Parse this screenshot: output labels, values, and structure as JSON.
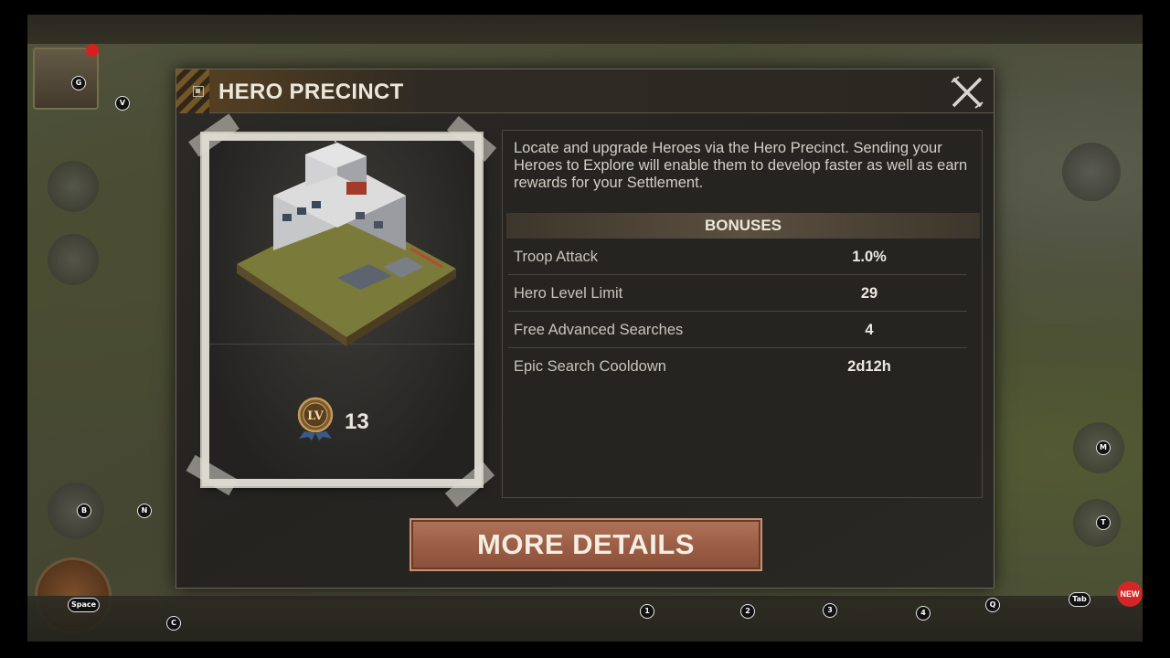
{
  "modal": {
    "title": "HERO PRECINCT",
    "description": "Locate and upgrade Heroes via the Hero Precinct. Sending your Heroes to Explore will enable them to develop faster as well as earn rewards for your Settlement.",
    "bonuses_title": "BONUSES",
    "bonuses": [
      {
        "label": "Troop Attack",
        "value": "1.0%"
      },
      {
        "label": "Hero Level Limit",
        "value": "29"
      },
      {
        "label": "Free Advanced Searches",
        "value": "4"
      },
      {
        "label": "Epic Search Cooldown",
        "value": "2d12h"
      }
    ],
    "level": "13",
    "more_details_label": "MORE DETAILS",
    "close_icon": "close-icon"
  },
  "key_hints": {
    "avatar": "G",
    "vip": "V",
    "b": "B",
    "n": "N",
    "space": "Space",
    "chat": "C",
    "slot1": "1",
    "slot2": "2",
    "slot3": "3",
    "slot4": "4",
    "backpack": "Q",
    "more": "Tab",
    "map": "M",
    "t": "T"
  },
  "colors": {
    "accent_button": "#9c5f46",
    "modal_background": "#252320",
    "header_accent": "#5a4221",
    "badge_red": "#d32626"
  }
}
